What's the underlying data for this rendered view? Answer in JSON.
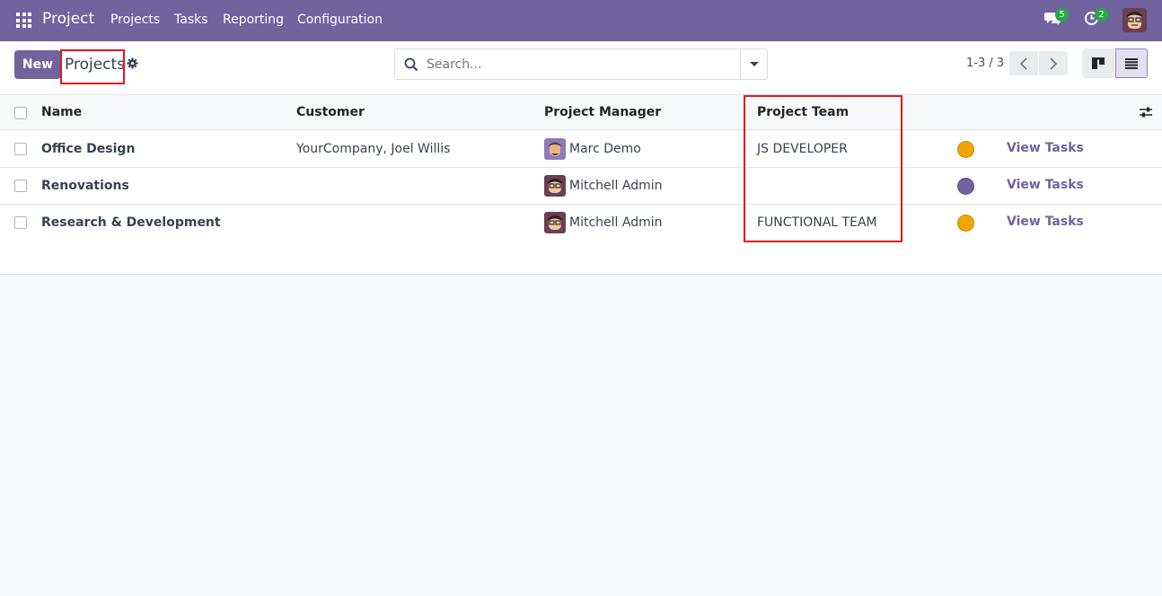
{
  "navbar": {
    "app_name": "Project",
    "menu": [
      "Projects",
      "Tasks",
      "Reporting",
      "Configuration"
    ],
    "chat_badge": "5",
    "activity_badge": "2"
  },
  "control_panel": {
    "new_label": "New",
    "title": "Projects",
    "search_placeholder": "Search...",
    "pager": "1-3 / 3"
  },
  "table": {
    "headers": {
      "name": "Name",
      "customer": "Customer",
      "manager": "Project Manager",
      "team": "Project Team"
    },
    "rows": [
      {
        "name": "Office Design",
        "customer": "YourCompany, Joel Willis",
        "manager": "Marc Demo",
        "team": "JS DEVELOPER",
        "color": "#f0a500",
        "action": "View Tasks"
      },
      {
        "name": "Renovations",
        "customer": "",
        "manager": "Mitchell Admin",
        "team": "",
        "color": "#71639e",
        "action": "View Tasks"
      },
      {
        "name": "Research & Development",
        "customer": "",
        "manager": "Mitchell Admin",
        "team": "FUNCTIONAL TEAM",
        "color": "#f0a500",
        "action": "View Tasks"
      }
    ]
  },
  "colors": {
    "brand": "#71639e",
    "highlight": "#e0191f"
  }
}
